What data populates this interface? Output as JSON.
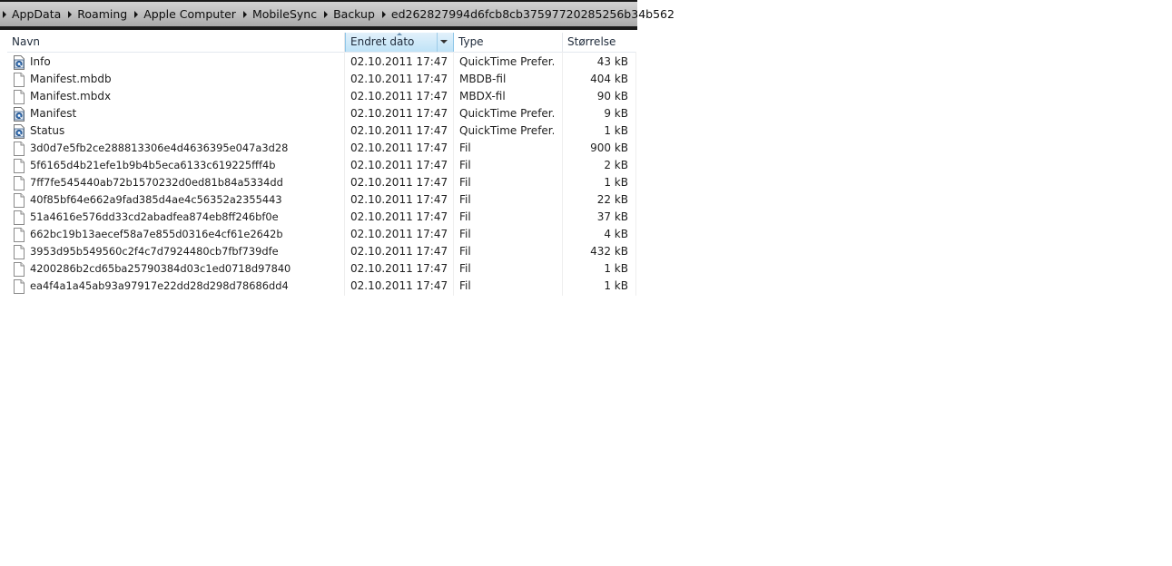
{
  "breadcrumb": [
    "AppData",
    "Roaming",
    "Apple Computer",
    "MobileSync",
    "Backup",
    "ed262827994d6fcb8cb37597720285256b34b562"
  ],
  "columns": {
    "name": "Navn",
    "date": "Endret dato",
    "type": "Type",
    "size": "Størrelse"
  },
  "files": [
    {
      "name": "Info",
      "date": "02.10.2011 17:47",
      "type": "QuickTime Prefer...",
      "size": "43 kB",
      "icon": "quicktime-plist-icon"
    },
    {
      "name": "Manifest.mbdb",
      "date": "02.10.2011 17:47",
      "type": "MBDB-fil",
      "size": "404 kB",
      "icon": "blank-file-icon"
    },
    {
      "name": "Manifest.mbdx",
      "date": "02.10.2011 17:47",
      "type": "MBDX-fil",
      "size": "90 kB",
      "icon": "blank-file-icon"
    },
    {
      "name": "Manifest",
      "date": "02.10.2011 17:47",
      "type": "QuickTime Prefer...",
      "size": "9 kB",
      "icon": "quicktime-plist-icon"
    },
    {
      "name": "Status",
      "date": "02.10.2011 17:47",
      "type": "QuickTime Prefer...",
      "size": "1 kB",
      "icon": "quicktime-plist-icon"
    },
    {
      "name": "3d0d7e5fb2ce288813306e4d4636395e047a3d28",
      "date": "02.10.2011 17:47",
      "type": "Fil",
      "size": "900 kB",
      "icon": "blank-file-icon"
    },
    {
      "name": "5f6165d4b21efe1b9b4b5eca6133c619225fff4b",
      "date": "02.10.2011 17:47",
      "type": "Fil",
      "size": "2 kB",
      "icon": "blank-file-icon"
    },
    {
      "name": "7ff7fe545440ab72b1570232d0ed81b84a5334dd",
      "date": "02.10.2011 17:47",
      "type": "Fil",
      "size": "1 kB",
      "icon": "blank-file-icon"
    },
    {
      "name": "40f85bf64e662a9fad385d4ae4c56352a2355443",
      "date": "02.10.2011 17:47",
      "type": "Fil",
      "size": "22 kB",
      "icon": "blank-file-icon"
    },
    {
      "name": "51a4616e576dd33cd2abadfea874eb8ff246bf0e",
      "date": "02.10.2011 17:47",
      "type": "Fil",
      "size": "37 kB",
      "icon": "blank-file-icon"
    },
    {
      "name": "662bc19b13aecef58a7e855d0316e4cf61e2642b",
      "date": "02.10.2011 17:47",
      "type": "Fil",
      "size": "4 kB",
      "icon": "blank-file-icon"
    },
    {
      "name": "3953d95b549560c2f4c7d7924480cb7fbf739dfe",
      "date": "02.10.2011 17:47",
      "type": "Fil",
      "size": "432 kB",
      "icon": "blank-file-icon"
    },
    {
      "name": "4200286b2cd65ba25790384d03c1ed0718d97840",
      "date": "02.10.2011 17:47",
      "type": "Fil",
      "size": "1 kB",
      "icon": "blank-file-icon"
    },
    {
      "name": "ea4f4a1a45ab93a97917e22dd28d298d78686dd4",
      "date": "02.10.2011 17:47",
      "type": "Fil",
      "size": "1 kB",
      "icon": "blank-file-icon"
    }
  ],
  "colors": {
    "selected_header_top": "#e2f1fb",
    "selected_header_bottom": "#bfe3f7",
    "addressbar_frame": "#1a1a1a"
  }
}
